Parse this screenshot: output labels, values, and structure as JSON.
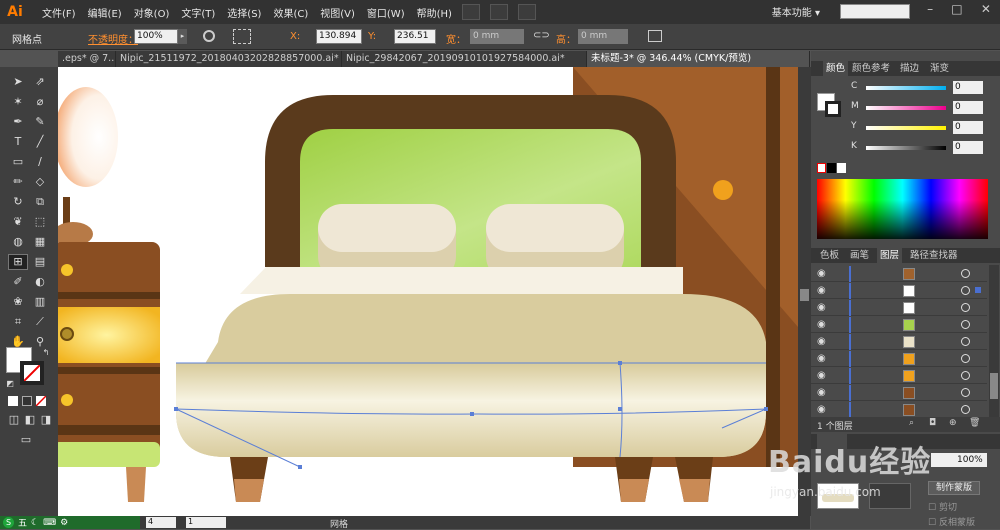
{
  "app": {
    "logo": "Ai"
  },
  "menu": [
    "文件(F)",
    "编辑(E)",
    "对象(O)",
    "文字(T)",
    "选择(S)",
    "效果(C)",
    "视图(V)",
    "窗口(W)",
    "帮助(H)"
  ],
  "workspace": "基本功能",
  "control": {
    "selection_label": "网格点",
    "opacity_label": "不透明度：",
    "opacity_value": "100%",
    "x_label": "X:",
    "x_value": "130.894",
    "y_label": "Y:",
    "y_value": "236.51",
    "w_label": "宽：",
    "w_value": "0 mm",
    "h_label": "高：",
    "h_value": "0 mm"
  },
  "tabs": [
    {
      "label": ".eps* @ 7..."
    },
    {
      "label": "Nipic_21511972_20180403202828857000.ai*"
    },
    {
      "label": "Nipic_29842067_20190910101927584000.ai*"
    },
    {
      "label": "未标题-3* @ 346.44% (CMYK/预览)"
    }
  ],
  "color_panel": {
    "tabs": [
      "颜色",
      "颜色参考",
      "描边",
      "渐变"
    ],
    "channels": [
      {
        "label": "C",
        "value": "0",
        "color": "#00aeef"
      },
      {
        "label": "M",
        "value": "0",
        "color": "#ec008c"
      },
      {
        "label": "Y",
        "value": "0",
        "color": "#fff200"
      },
      {
        "label": "K",
        "value": "0",
        "color": "#000000"
      }
    ]
  },
  "layers_panel": {
    "tabs": [
      "色板",
      "画笔",
      "图层",
      "路径查找器"
    ],
    "rows": [
      {
        "thumb": "#a0622d"
      },
      {
        "thumb": "#ffffff"
      },
      {
        "thumb": "#ffffff"
      },
      {
        "thumb": "#a7d24d"
      },
      {
        "thumb": "#eae2c9"
      },
      {
        "thumb": "#f0a11d"
      },
      {
        "thumb": "#f0a11d"
      },
      {
        "thumb": "#8a4e22"
      },
      {
        "thumb": "#8a4e22"
      }
    ],
    "footer": "1 个图层"
  },
  "transparency_panel": {
    "opacity_value": "100%",
    "mask_button": "制作蒙版",
    "clip_label": "剪切",
    "invert_label": "反相蒙版"
  },
  "status": {
    "zoom": "4",
    "page": "1",
    "tool_name": "网格"
  },
  "taskbar": {
    "ime": "五"
  },
  "watermark": {
    "brand": "Baidu经验",
    "url": "jingyan.baidu.com"
  },
  "colors": {
    "accent": "#ff7c00",
    "headboard": "#5a3a1c",
    "headboard_panel": "#a7d24d",
    "pillow": "#eae2c9",
    "mattress": "#d9cc9e",
    "wood": "#8a4e22",
    "drawer_glow": "#f6c42a",
    "knob": "#f0a11d"
  }
}
